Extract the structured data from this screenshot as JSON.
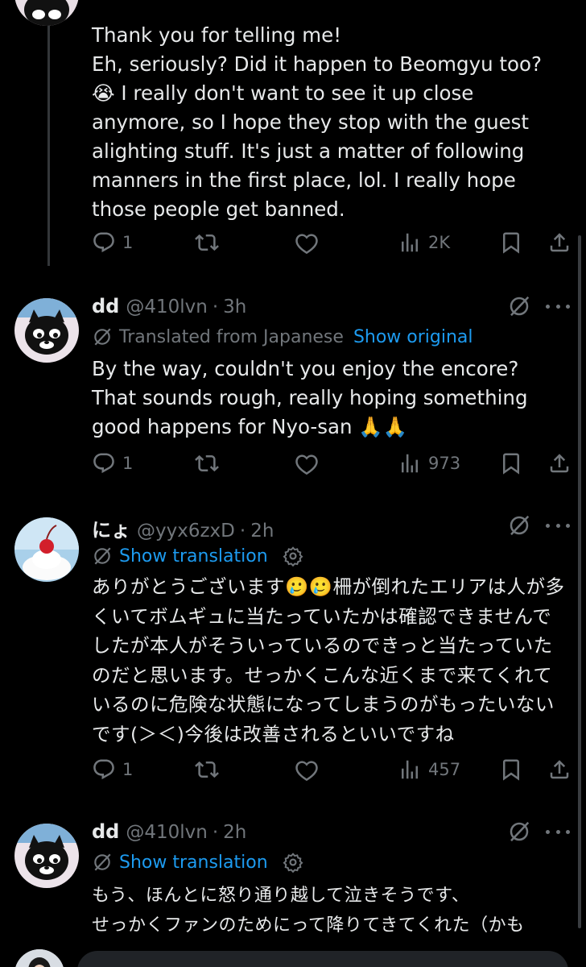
{
  "posts": [
    {
      "body": "Thank you for telling me!\nEh, seriously? Did it happen to Beomgyu too? 😭 I really don't want to see it up close anymore, so I hope they stop with the guest alighting stuff. It's just a matter of following manners in the first place, lol. I really hope those people get banned.",
      "replies": "1",
      "views": "2K"
    },
    {
      "name": "dd",
      "handle": "@410lvn",
      "time": "3h",
      "translated_note": "Translated from Japanese",
      "translation_link": "Show original",
      "body": "By the way, couldn't you enjoy the encore? That sounds rough, really hoping something good happens for Nyo-san 🙏🙏",
      "replies": "1",
      "views": "973"
    },
    {
      "name": "にょ",
      "handle": "@yyx6zxD",
      "time": "2h",
      "translation_link": "Show translation",
      "body": "ありがとうございます🥲🥲柵が倒れたエリアは人が多くいてボムギュに当たっていたかは確認できませんでしたが本人がそういっているのできっと当たっていたのだと思います。せっかくこんな近くまで来てくれているのに危険な状態になってしまうのがもったいないです(＞＜)今後は改善されるといいですね",
      "replies": "1",
      "views": "457"
    },
    {
      "name": "dd",
      "handle": "@410lvn",
      "time": "2h",
      "translation_link": "Show translation",
      "body": "もう、ほんとに怒り通り越して泣きそうです、\nせっかくファンのためにって降りてきてくれた（かも"
    }
  ],
  "separator": "·",
  "icons": {
    "reply": "reply-icon",
    "repost": "repost-icon",
    "like": "like-icon",
    "views": "views-icon",
    "bookmark": "bookmark-icon",
    "share": "share-icon",
    "grok": "grok-icon",
    "more": "more-icon",
    "translate": "translate-icon",
    "settings": "gear-icon"
  },
  "colors": {
    "background": "#000000",
    "text": "#e7e9ea",
    "muted": "#71767b",
    "link": "#1d9bf0",
    "thread_line": "#333639"
  }
}
